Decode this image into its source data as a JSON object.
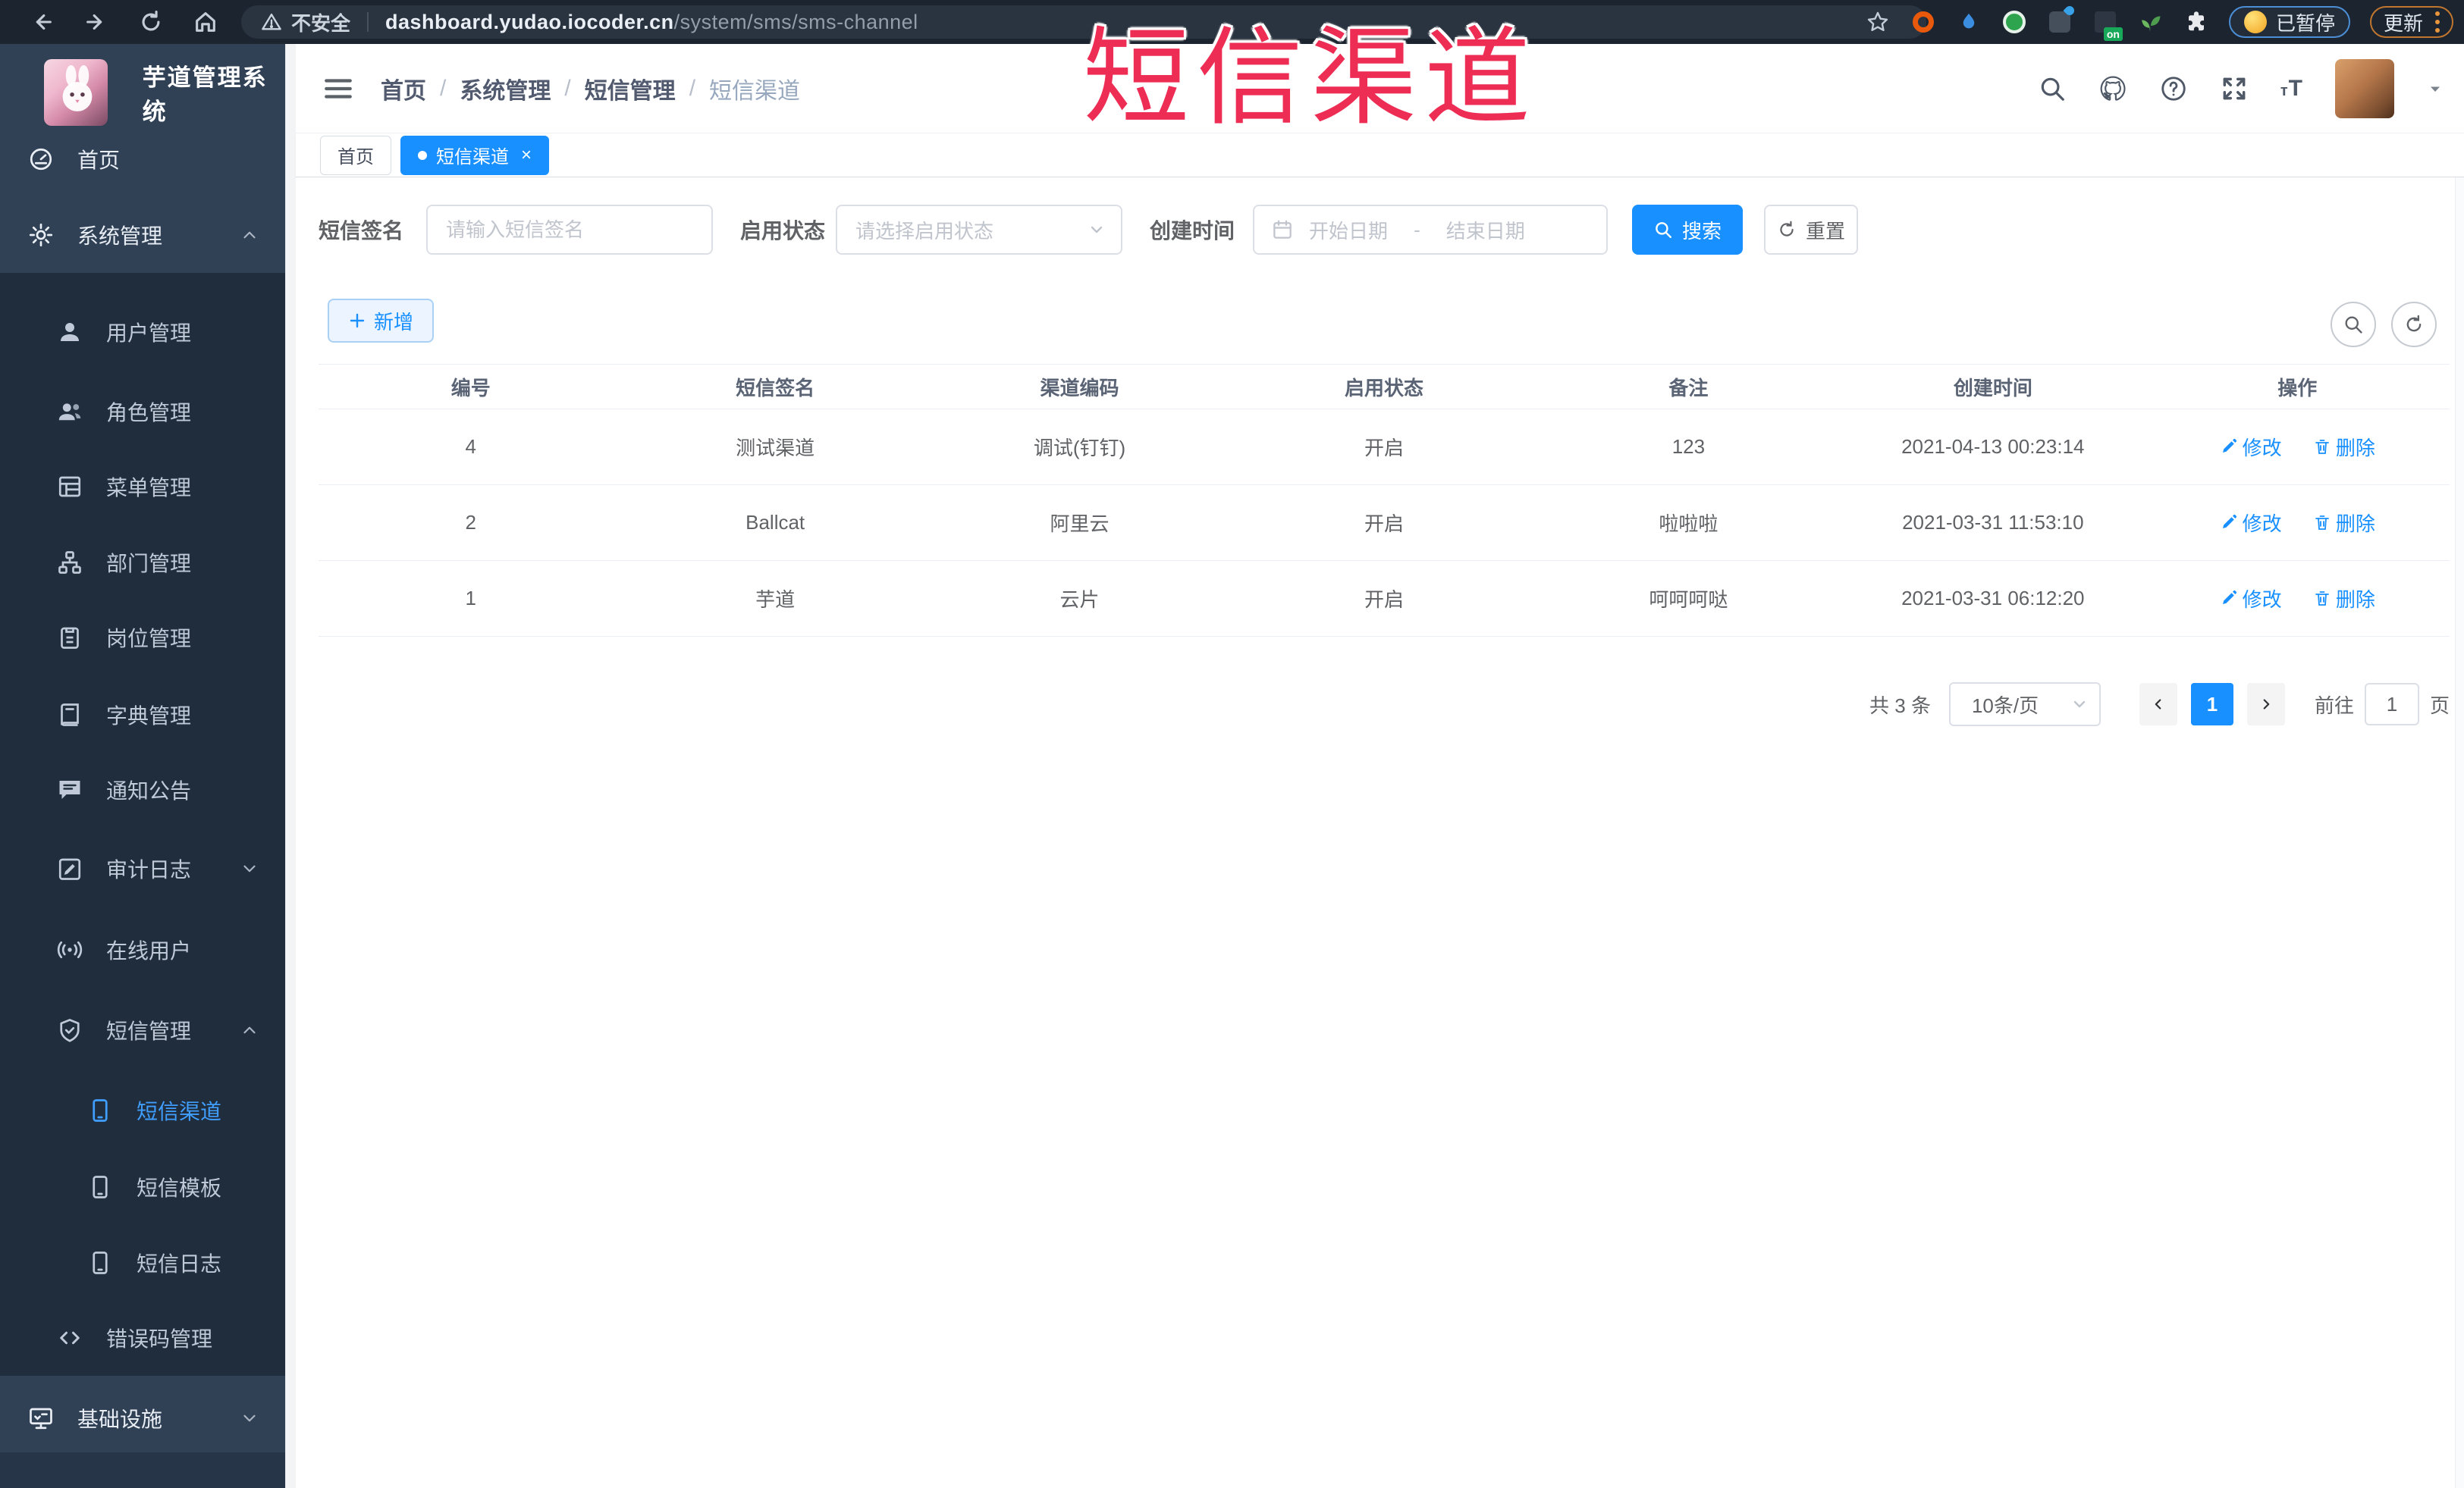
{
  "browser": {
    "security_label": "不安全",
    "url_host": "dashboard.yudao.iocoder.cn",
    "url_path": "/system/sms/sms-channel",
    "extension_badge": "on",
    "paused_label": "已暂停",
    "update_label": "更新"
  },
  "watermark": {
    "text": "短信渠道",
    "color": "#ee2d55"
  },
  "sidebar": {
    "title": "芋道管理系统",
    "items": [
      {
        "label": "首页",
        "level": 1
      },
      {
        "label": "系统管理",
        "level": 1,
        "chevron": "up"
      },
      {
        "label": "用户管理",
        "level": 2
      },
      {
        "label": "角色管理",
        "level": 2
      },
      {
        "label": "菜单管理",
        "level": 2
      },
      {
        "label": "部门管理",
        "level": 2
      },
      {
        "label": "岗位管理",
        "level": 2
      },
      {
        "label": "字典管理",
        "level": 2
      },
      {
        "label": "通知公告",
        "level": 2
      },
      {
        "label": "审计日志",
        "level": 2,
        "chevron": "down"
      },
      {
        "label": "在线用户",
        "level": 2
      },
      {
        "label": "短信管理",
        "level": 2,
        "chevron": "up"
      },
      {
        "label": "短信渠道",
        "level": 3,
        "active": true
      },
      {
        "label": "短信模板",
        "level": 3
      },
      {
        "label": "短信日志",
        "level": 3
      },
      {
        "label": "错误码管理",
        "level": 2
      },
      {
        "label": "基础设施",
        "level": 1,
        "chevron": "down"
      }
    ]
  },
  "header": {
    "breadcrumb": [
      "首页",
      "系统管理",
      "短信管理",
      "短信渠道"
    ]
  },
  "tabs": [
    {
      "label": "首页",
      "active": false
    },
    {
      "label": "短信渠道",
      "active": true,
      "close": "×"
    }
  ],
  "filters": {
    "sign_label": "短信签名",
    "sign_placeholder": "请输入短信签名",
    "status_label": "启用状态",
    "status_placeholder": "请选择启用状态",
    "time_label": "创建时间",
    "start_placeholder": "开始日期",
    "range_separator": "-",
    "end_placeholder": "结束日期",
    "search_label": "搜索",
    "reset_label": "重置"
  },
  "toolbar": {
    "add_label": "新增"
  },
  "table": {
    "columns": [
      "编号",
      "短信签名",
      "渠道编码",
      "启用状态",
      "备注",
      "创建时间",
      "操作"
    ],
    "edit_label": "修改",
    "delete_label": "删除",
    "rows": [
      {
        "id": "4",
        "sign": "测试渠道",
        "code": "调试(钉钉)",
        "status": "开启",
        "remark": "123",
        "created": "2021-04-13 00:23:14"
      },
      {
        "id": "2",
        "sign": "Ballcat",
        "code": "阿里云",
        "status": "开启",
        "remark": "啦啦啦",
        "created": "2021-03-31 11:53:10"
      },
      {
        "id": "1",
        "sign": "芋道",
        "code": "云片",
        "status": "开启",
        "remark": "呵呵呵哒",
        "created": "2021-03-31 06:12:20"
      }
    ]
  },
  "pagination": {
    "total_label": "共 3 条",
    "page_size_label": "10条/页",
    "current_page": "1",
    "goto_label": "前往",
    "goto_value": "1",
    "page_suffix_label": "页"
  },
  "colors": {
    "accent": "#1890ff",
    "sidebar_bg": "#304156",
    "sidebar_sub_bg": "#1f2d3d"
  }
}
